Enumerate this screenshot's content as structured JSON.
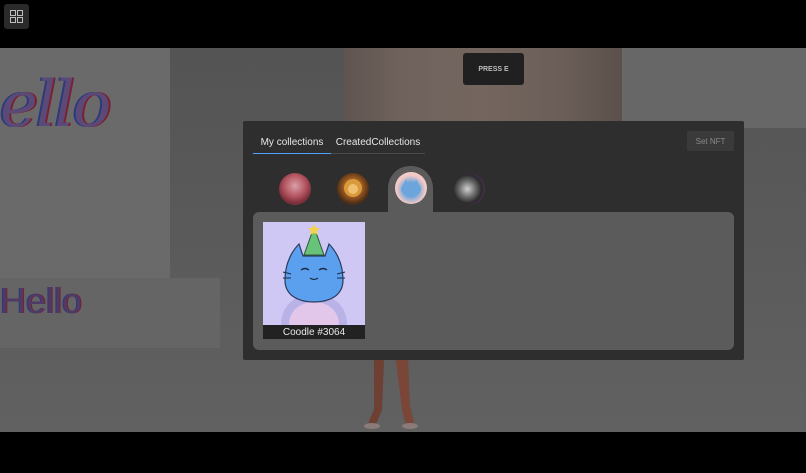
{
  "menu": {
    "icon": "grid-icon"
  },
  "hint": {
    "label": "PRESS E"
  },
  "scene": {
    "hello_script": "ello",
    "hello_text": "Hello"
  },
  "panel": {
    "tabs": [
      {
        "label": "My collections",
        "active": true
      },
      {
        "label": "CreatedCollections",
        "active": false
      }
    ],
    "set_button": "Set NFT",
    "collections": [
      {
        "avatar": "collection-avatar-1"
      },
      {
        "avatar": "collection-avatar-2"
      },
      {
        "avatar": "collection-avatar-3",
        "selected": true
      },
      {
        "avatar": "collection-avatar-4"
      }
    ],
    "nfts": [
      {
        "name": "Coodle #3064"
      }
    ]
  },
  "colors": {
    "accent": "#4da3ff",
    "panel_bg": "#2e2e2e",
    "content_bg": "#5b5b5b"
  }
}
